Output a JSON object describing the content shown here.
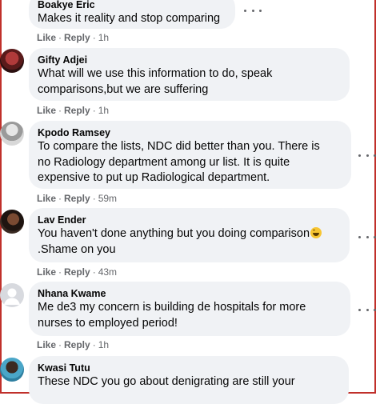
{
  "comments": [
    {
      "author": "Boakye Eric",
      "lines": [
        "Makes it reality and stop comparing"
      ],
      "like": "Like",
      "reply": "Reply",
      "time": "1h"
    },
    {
      "author": "Gifty Adjei",
      "lines": [
        "What will we use this information to do, speak",
        "comparisons,but we are suffering"
      ],
      "like": "Like",
      "reply": "Reply",
      "time": "1h"
    },
    {
      "author": "Kpodo Ramsey",
      "lines": [
        "To compare the lists, NDC did better than you. There is",
        "no Radiology department among ur list. It is quite",
        "expensive to put up Radiological department."
      ],
      "like": "Like",
      "reply": "Reply",
      "time": "59m"
    },
    {
      "author": "Lav Ender",
      "lines": [
        "You haven't done anything but you doing comparison",
        ".Shame on you"
      ],
      "like": "Like",
      "reply": "Reply",
      "time": "43m"
    },
    {
      "author": "Nhana Kwame",
      "lines": [
        "Me de3 my concern is building de hospitals for more",
        "nurses to employed period!"
      ],
      "like": "Like",
      "reply": "Reply",
      "time": "1h"
    },
    {
      "author": "Kwasi Tutu",
      "lines": [
        "These NDC you go about denigrating are still your"
      ]
    }
  ],
  "colors": {
    "bubble": "#f0f2f5",
    "meta": "#65676b",
    "frame": "#c0302b"
  },
  "icons": [
    "more-options-icon",
    "laughing-emoji-icon",
    "avatar-placeholder-icon"
  ]
}
